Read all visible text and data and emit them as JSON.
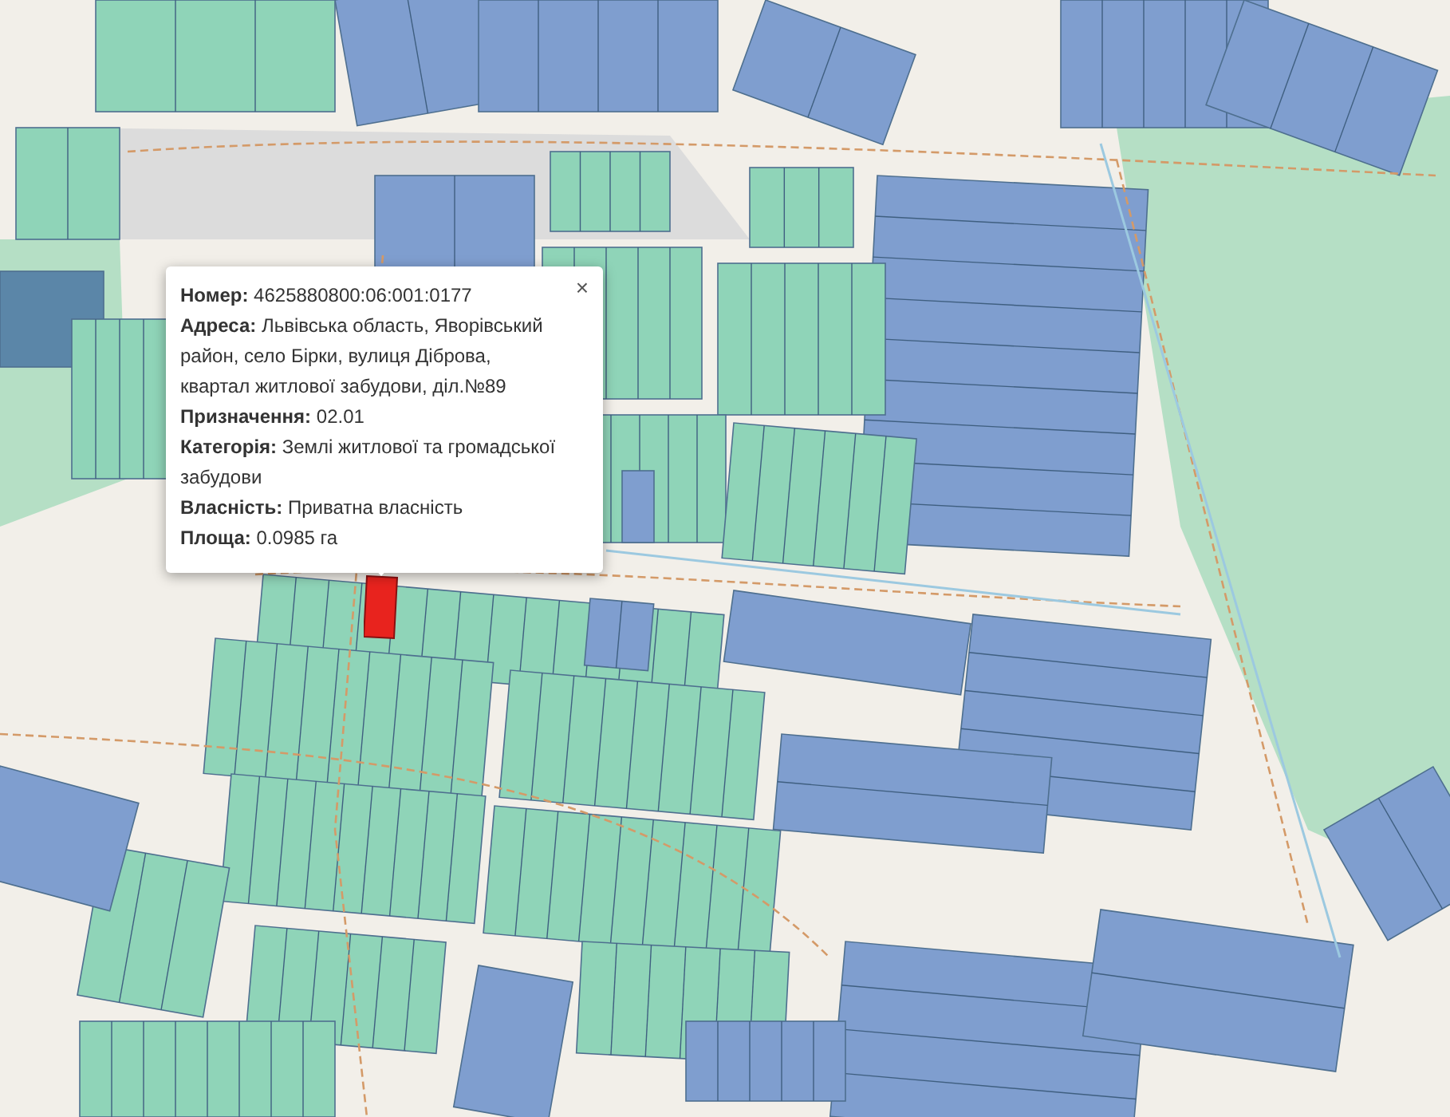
{
  "map": {
    "popup": {
      "close": "×",
      "lines": [
        "**Номер:** 4625880800:06:001:0177",
        "**Адреса:** Львівська область, Яворівський район, село Бірки, вулиця Діброва, квартал житлової забудови, діл.№89",
        "**Призначення:** 02.01",
        "**Категорія:** Землі житлової та громадської забудови",
        "**Власність:** Приватна власність",
        "**Площа:** 0.0985 га"
      ]
    }
  }
}
